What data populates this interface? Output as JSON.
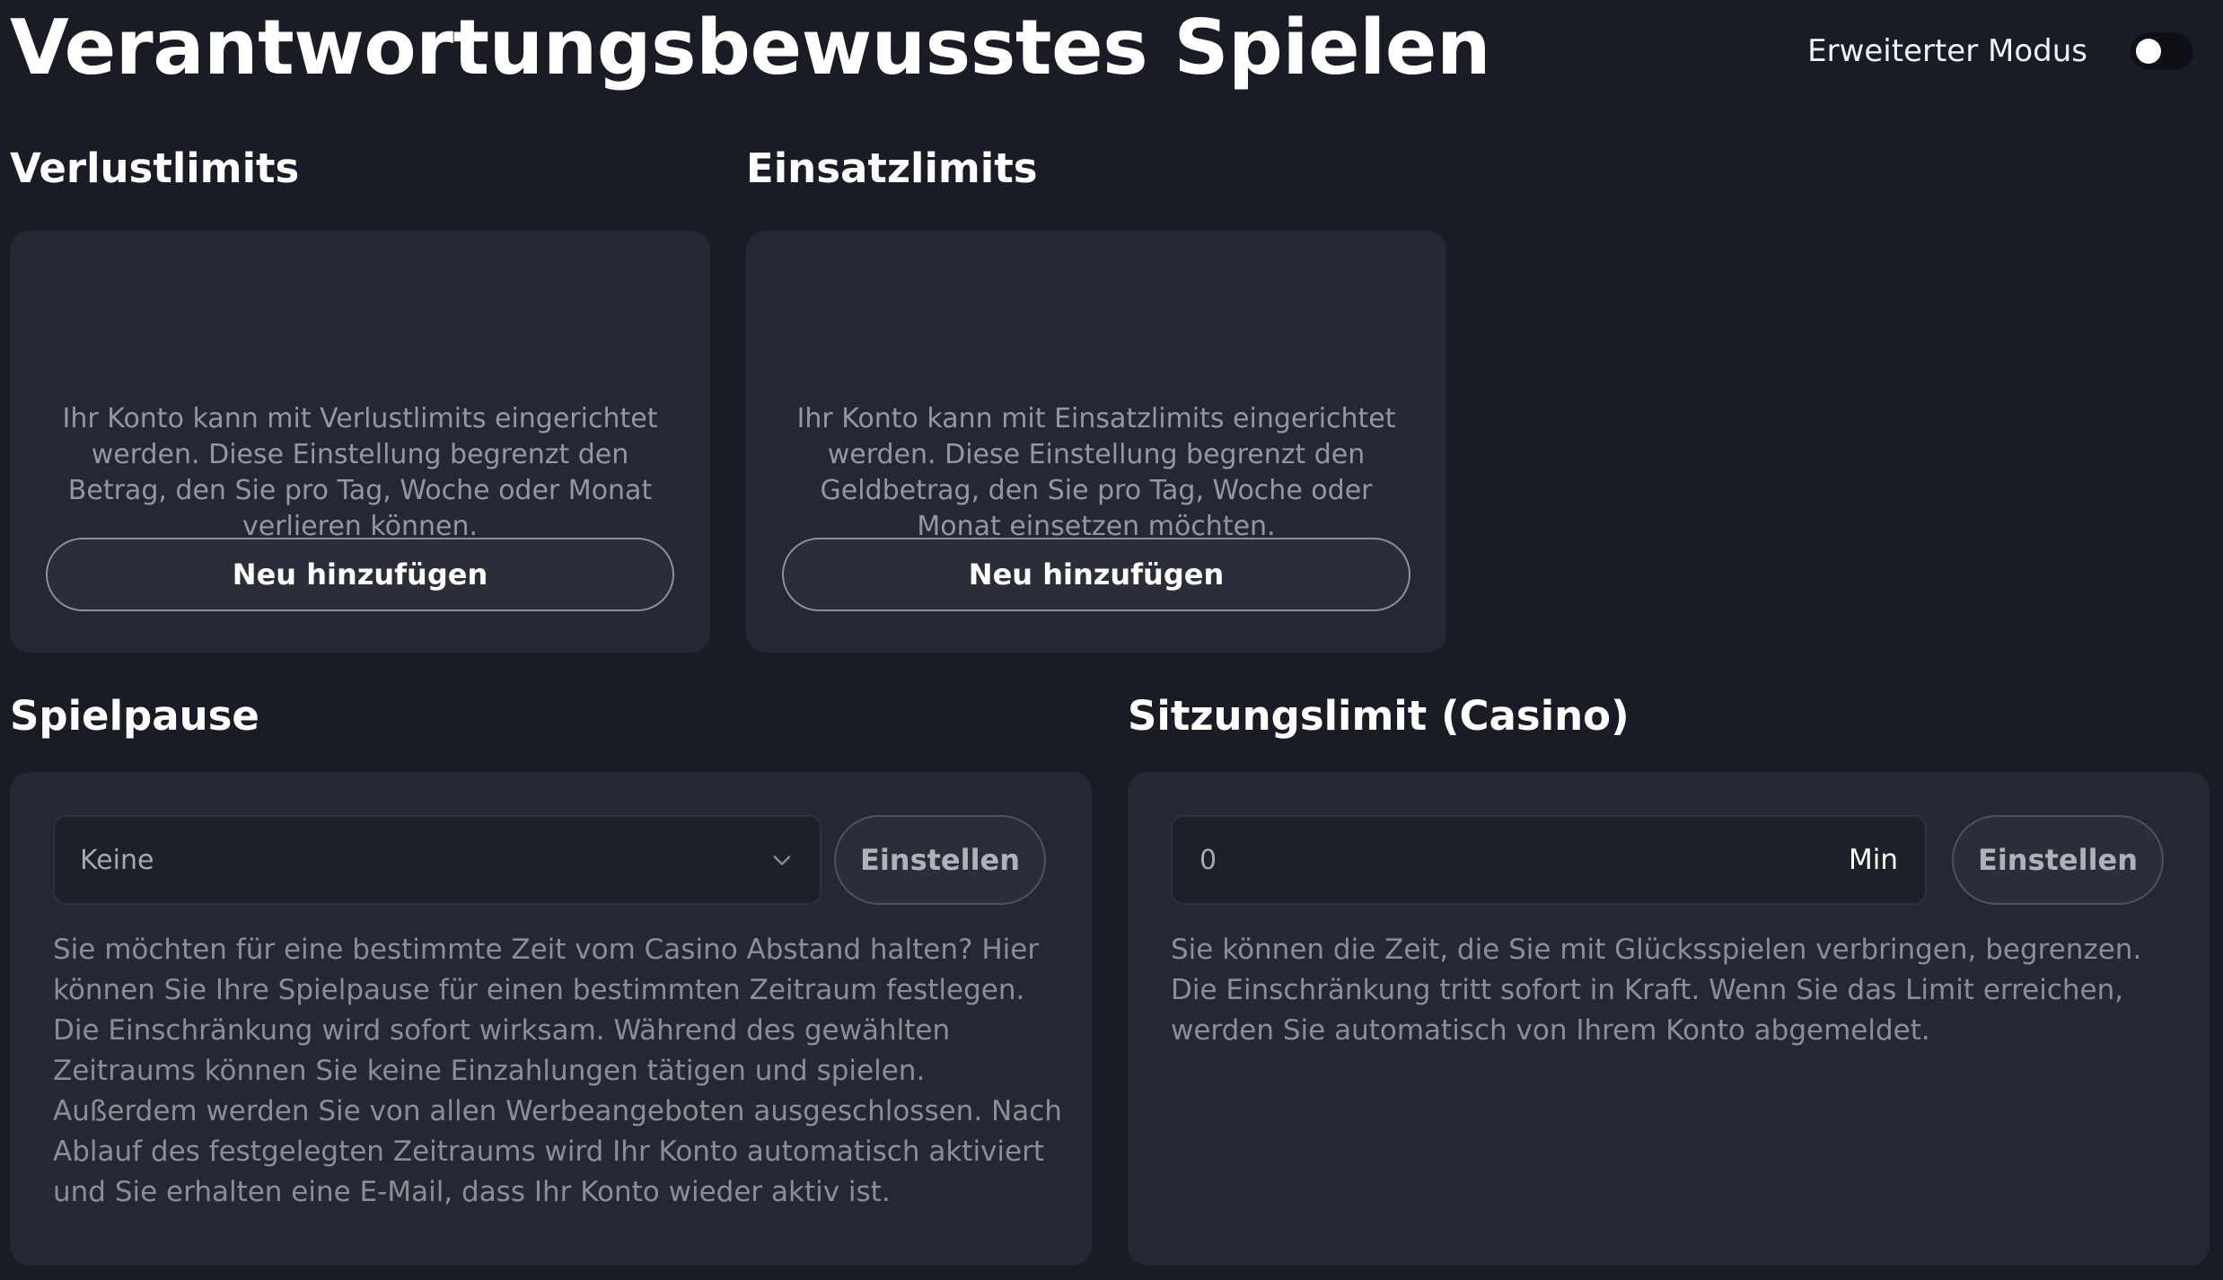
{
  "header": {
    "title": "Verantwortungsbewusstes Spielen",
    "advanced_mode_label": "Erweiterter Modus",
    "advanced_mode_enabled": false
  },
  "loss_limits": {
    "heading": "Verlustlimits",
    "description": "Ihr Konto kann mit Verlustlimits eingerichtet werden. Diese Einstellung begrenzt den Betrag, den Sie pro Tag, Woche oder Monat verlieren können.",
    "add_button": "Neu hinzufügen"
  },
  "bet_limits": {
    "heading": "Einsatzlimits",
    "description": "Ihr Konto kann mit Einsatzlimits eingerichtet werden. Diese Einstellung begrenzt den Geldbetrag, den Sie pro Tag, Woche oder Monat einsetzen möchten.",
    "add_button": "Neu hinzufügen"
  },
  "game_pause": {
    "heading": "Spielpause",
    "select_value": "Keine",
    "set_button": "Einstellen",
    "description": "Sie möchten für eine bestimmte Zeit vom Casino Abstand halten? Hier können Sie Ihre Spielpause für einen bestimmten Zeitraum festlegen. Die Einschränkung wird sofort wirksam. Während des gewählten Zeitraums können Sie keine Einzahlungen tätigen und spielen. Außerdem werden Sie von allen Werbeangeboten ausgeschlossen. Nach Ablauf des festgelegten Zeitraums wird Ihr Konto automatisch aktiviert und Sie erhalten eine E-Mail, dass Ihr Konto wieder aktiv ist."
  },
  "session_limit": {
    "heading": "Sitzungslimit (Casino)",
    "input_value": "0",
    "unit": "Min",
    "set_button": "Einstellen",
    "description": "Sie können die Zeit, die Sie mit Glücksspielen verbringen, begrenzen. Die Einschränkung tritt sofort in Kraft. Wenn Sie das Limit erreichen, werden Sie automatisch von Ihrem Konto abgemeldet."
  },
  "icons": {
    "select_chevron": "chevron-down-icon"
  },
  "colors": {
    "background": "#191c24",
    "card": "#252833",
    "input": "#1d2029",
    "muted_text": "#8c8e97"
  }
}
